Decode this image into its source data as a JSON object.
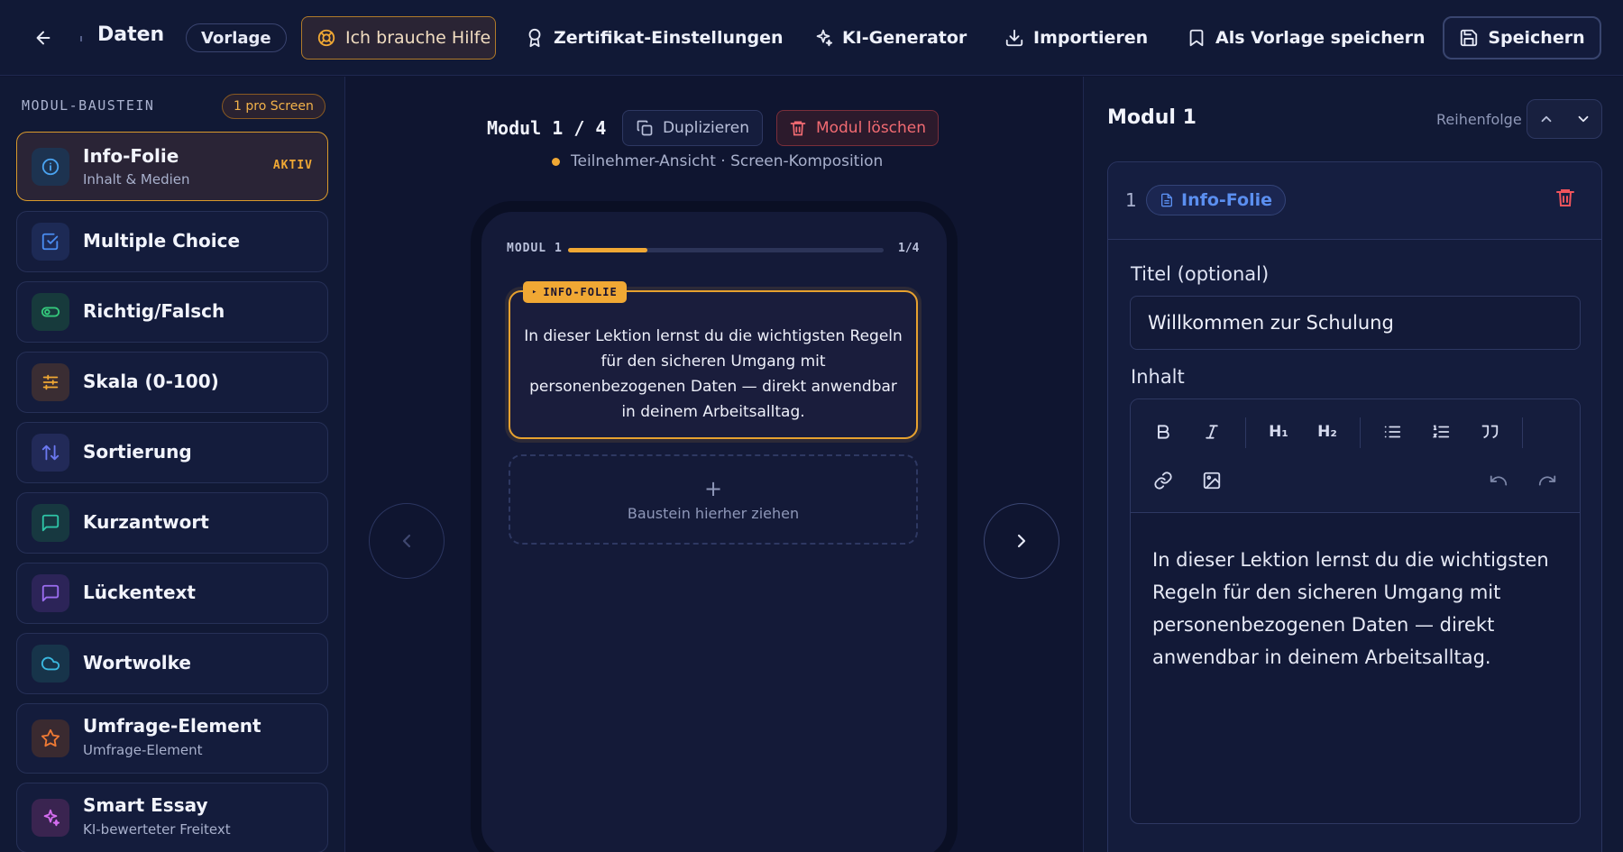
{
  "topbar": {
    "breadcrumb": "Daten:",
    "template_pill": "Vorlage",
    "help_label": "Ich brauche Hilfe",
    "certificate_label": "Zertifikat-Einstellungen",
    "ai_label": "KI-Generator",
    "import_label": "Importieren",
    "save_template_label": "Als Vorlage speichern",
    "save_label": "Speichern"
  },
  "sidebar": {
    "heading": "MODUL-BAUSTEIN",
    "badge": "1 pro Screen",
    "active_label": "AKTIV",
    "items": [
      {
        "title": "Info-Folie",
        "subtitle": "Inhalt & Medien",
        "icon": "info-icon",
        "color": "#4aa3f0"
      },
      {
        "title": "Multiple Choice",
        "subtitle": "",
        "icon": "checkbox-icon",
        "color": "#4a8cf0"
      },
      {
        "title": "Richtig/Falsch",
        "subtitle": "",
        "icon": "toggle-icon",
        "color": "#34c77b"
      },
      {
        "title": "Skala (0-100)",
        "subtitle": "",
        "icon": "sliders-icon",
        "color": "#f0a834"
      },
      {
        "title": "Sortierung",
        "subtitle": "",
        "icon": "sort-arrows-icon",
        "color": "#6b78f0"
      },
      {
        "title": "Kurzantwort",
        "subtitle": "",
        "icon": "chat-icon",
        "color": "#2ec4a6"
      },
      {
        "title": "Lückentext",
        "subtitle": "",
        "icon": "message-icon",
        "color": "#9b6df0"
      },
      {
        "title": "Wortwolke",
        "subtitle": "",
        "icon": "cloud-icon",
        "color": "#3ab8e0"
      },
      {
        "title": "Umfrage-Element",
        "subtitle": "Umfrage-Element",
        "icon": "star-icon",
        "color": "#f07a34"
      },
      {
        "title": "Smart Essay",
        "subtitle": "KI-bewerteter Freitext",
        "icon": "sparkle-icon",
        "color": "#d56df0"
      }
    ]
  },
  "center": {
    "module_label": "Modul 1 / 4",
    "duplicate_label": "Duplizieren",
    "delete_label": "Modul löschen",
    "subtitle": "Teilnehmer-Ansicht · Screen-Komposition",
    "phone": {
      "module_tag": "MODUL 1",
      "progress": 0.25,
      "count": "1/4",
      "slide_tag": "INFO-FOLIE",
      "slide_text": "In dieser Lektion lernst du die wichtigsten Regeln für den sicheren Umgang mit personenbezogenen Daten — direkt anwendbar in deinem Arbeitsalltag.",
      "drop_hint": "Baustein hierher ziehen"
    }
  },
  "right": {
    "title": "Modul 1",
    "order_label": "Reihenfolge",
    "block_number": "1",
    "block_tag": "Info-Folie",
    "title_field_label": "Titel (optional)",
    "title_field_value": "Willkommen zur Schulung",
    "content_label": "Inhalt",
    "toolbar": [
      "B",
      "I",
      "H₁",
      "H₂",
      "bullet-list",
      "numbered-list",
      "quote",
      "link",
      "image",
      "undo",
      "redo"
    ],
    "content_text": "In dieser Lektion lernst du die wichtigsten Regeln für den sicheren Umgang mit personenbezogenen Daten — direkt anwendbar in deinem Arbeitsalltag."
  },
  "colors": {
    "accent": "#f0a834",
    "danger": "#f26b72",
    "link": "#5b8ff0",
    "background": "#0f1530"
  }
}
